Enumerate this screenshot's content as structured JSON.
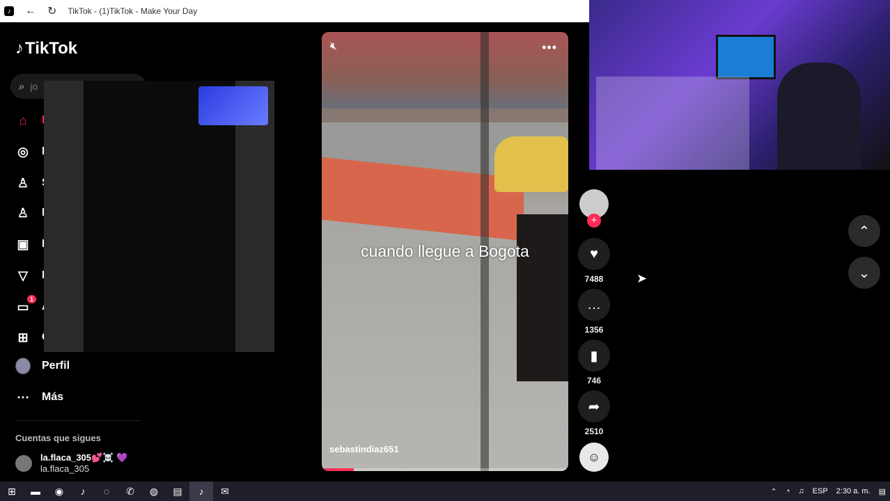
{
  "window": {
    "title": "TikTok - (1)TikTok - Make Your Day"
  },
  "brand": {
    "name": "TikTok",
    "accent": "#fe2c55"
  },
  "search": {
    "value": "jo"
  },
  "nav": [
    {
      "icon": "home-icon",
      "label": "P"
    },
    {
      "icon": "compass-icon",
      "label": "E"
    },
    {
      "icon": "following-icon",
      "label": "S"
    },
    {
      "icon": "friends-icon",
      "label": "F"
    },
    {
      "icon": "live-icon",
      "label": "L"
    },
    {
      "icon": "messages-icon",
      "label": "M"
    },
    {
      "icon": "activity-icon",
      "label": "A",
      "badge": "1"
    },
    {
      "icon": "upload-icon",
      "label": "C"
    },
    {
      "icon": "profile-avatar",
      "label": "Perfil"
    },
    {
      "icon": "more-icon",
      "label": "Más"
    }
  ],
  "following": {
    "heading": "Cuentas que sigues",
    "accounts": [
      {
        "name": "la.flaca_305💕☠️ 💜",
        "username": "la.flaca_305"
      }
    ]
  },
  "video": {
    "caption": "cuando llegue a Bogota",
    "author": "sebastindiaz651",
    "progress": 0.13
  },
  "actions": {
    "likes": "7488",
    "comments": "1356",
    "saves": "746",
    "shares": "2510"
  },
  "tray": {
    "lang": "ESP",
    "time": "2:30 a. m."
  }
}
